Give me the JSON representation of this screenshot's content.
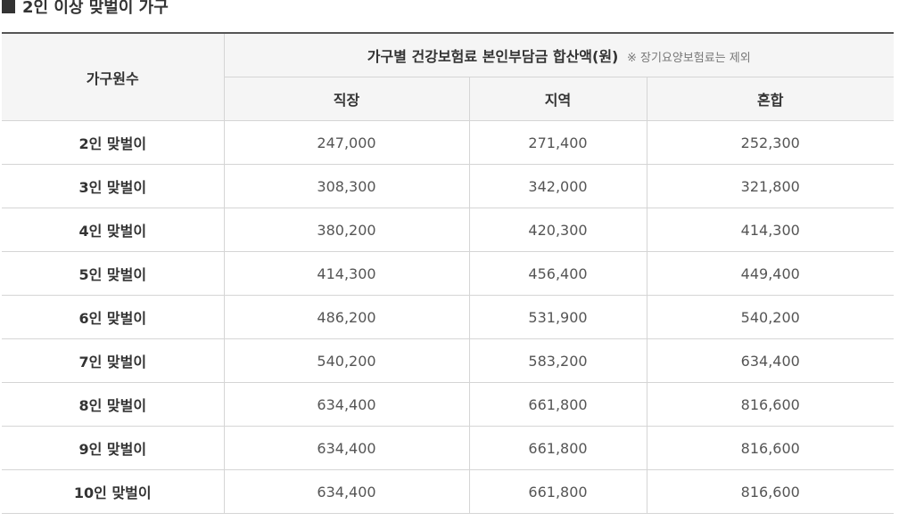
{
  "section": {
    "title": "2인 이상 맞벌이 가구"
  },
  "table": {
    "header_row_label": "가구원수",
    "group_header": "가구별 건강보험료 본인부담금 합산액(원)",
    "group_note": "※ 장기요양보험료는 제외",
    "columns": [
      "직장",
      "지역",
      "혼합"
    ],
    "rows": [
      {
        "label": "2인 맞벌이",
        "values": [
          "247,000",
          "271,400",
          "252,300"
        ]
      },
      {
        "label": "3인 맞벌이",
        "values": [
          "308,300",
          "342,000",
          "321,800"
        ]
      },
      {
        "label": "4인 맞벌이",
        "values": [
          "380,200",
          "420,300",
          "414,300"
        ]
      },
      {
        "label": "5인 맞벌이",
        "values": [
          "414,300",
          "456,400",
          "449,400"
        ]
      },
      {
        "label": "6인 맞벌이",
        "values": [
          "486,200",
          "531,900",
          "540,200"
        ]
      },
      {
        "label": "7인 맞벌이",
        "values": [
          "540,200",
          "583,200",
          "634,400"
        ]
      },
      {
        "label": "8인 맞벌이",
        "values": [
          "634,400",
          "661,800",
          "816,600"
        ]
      },
      {
        "label": "9인 맞벌이",
        "values": [
          "634,400",
          "661,800",
          "816,600"
        ]
      },
      {
        "label": "10인 맞벌이",
        "values": [
          "634,400",
          "661,800",
          "816,600"
        ]
      }
    ]
  }
}
